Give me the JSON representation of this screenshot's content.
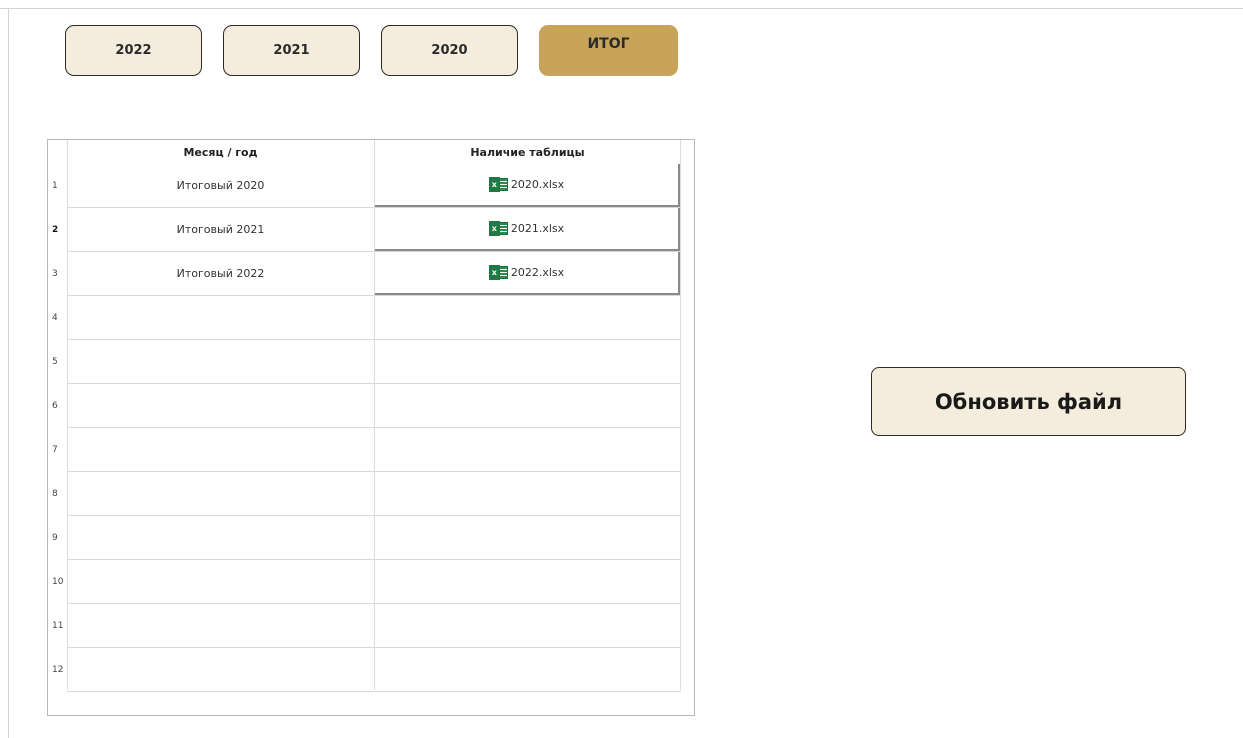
{
  "tabs": [
    {
      "label": "2022",
      "active": false
    },
    {
      "label": "2021",
      "active": false
    },
    {
      "label": "2020",
      "active": false
    },
    {
      "label": "ИТОГ",
      "active": true
    }
  ],
  "colors": {
    "tab_bg": "#f4ecdc",
    "tab_active_bg": "#c8a45a",
    "excel_green": "#1f7a45"
  },
  "table": {
    "columns": [
      "Месяц / год",
      "Наличие таблицы"
    ],
    "rows": [
      {
        "num": "1",
        "period": "Итоговый 2020",
        "file": "2020.xlsx",
        "icon": "excel-file-icon",
        "icon_letter": "x"
      },
      {
        "num": "2",
        "period": "Итоговый 2021",
        "file": "2021.xlsx",
        "icon": "excel-file-icon",
        "icon_letter": "x"
      },
      {
        "num": "3",
        "period": "Итоговый 2022",
        "file": "2022.xlsx",
        "icon": "excel-file-icon",
        "icon_letter": "x"
      },
      {
        "num": "4",
        "period": "",
        "file": ""
      },
      {
        "num": "5",
        "period": "",
        "file": ""
      },
      {
        "num": "6",
        "period": "",
        "file": ""
      },
      {
        "num": "7",
        "period": "",
        "file": ""
      },
      {
        "num": "8",
        "period": "",
        "file": ""
      },
      {
        "num": "9",
        "period": "",
        "file": ""
      },
      {
        "num": "10",
        "period": "",
        "file": ""
      },
      {
        "num": "11",
        "period": "",
        "file": ""
      },
      {
        "num": "12",
        "period": "",
        "file": ""
      }
    ]
  },
  "update_button": {
    "label": "Обновить файл"
  }
}
